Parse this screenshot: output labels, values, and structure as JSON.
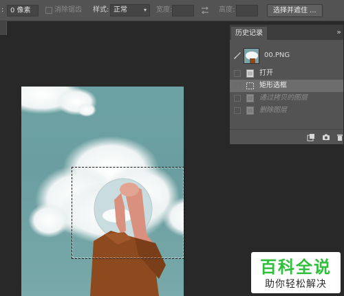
{
  "options_bar": {
    "feather_prefix": ":",
    "feather_value": "0 像素",
    "antialias_label": "消除锯齿",
    "style_label": "样式:",
    "style_value": "正常",
    "width_label": "宽度:",
    "height_label": "高度:",
    "select_mask_button": "选择并遮住 ..."
  },
  "history_panel": {
    "tab_label": "历史记录",
    "menu_glyph": "»",
    "snapshot_name": "00.PNG",
    "steps": [
      {
        "label": "打开",
        "state": "normal"
      },
      {
        "label": "矩形选框",
        "state": "active"
      },
      {
        "label": "通过拷贝的图层",
        "state": "undone"
      },
      {
        "label": "删除图层",
        "state": "undone"
      }
    ],
    "footer_icons": [
      "new-document-from-state-icon",
      "camera-icon",
      "trash-icon"
    ]
  },
  "watermark": {
    "title": "百科全说",
    "subtitle": "助你轻松解决"
  },
  "colors": {
    "ui_bar": "#535353",
    "canvas_bg": "#282828",
    "sky": "#6da2a4",
    "watermark_green": "#2fbf3a"
  }
}
